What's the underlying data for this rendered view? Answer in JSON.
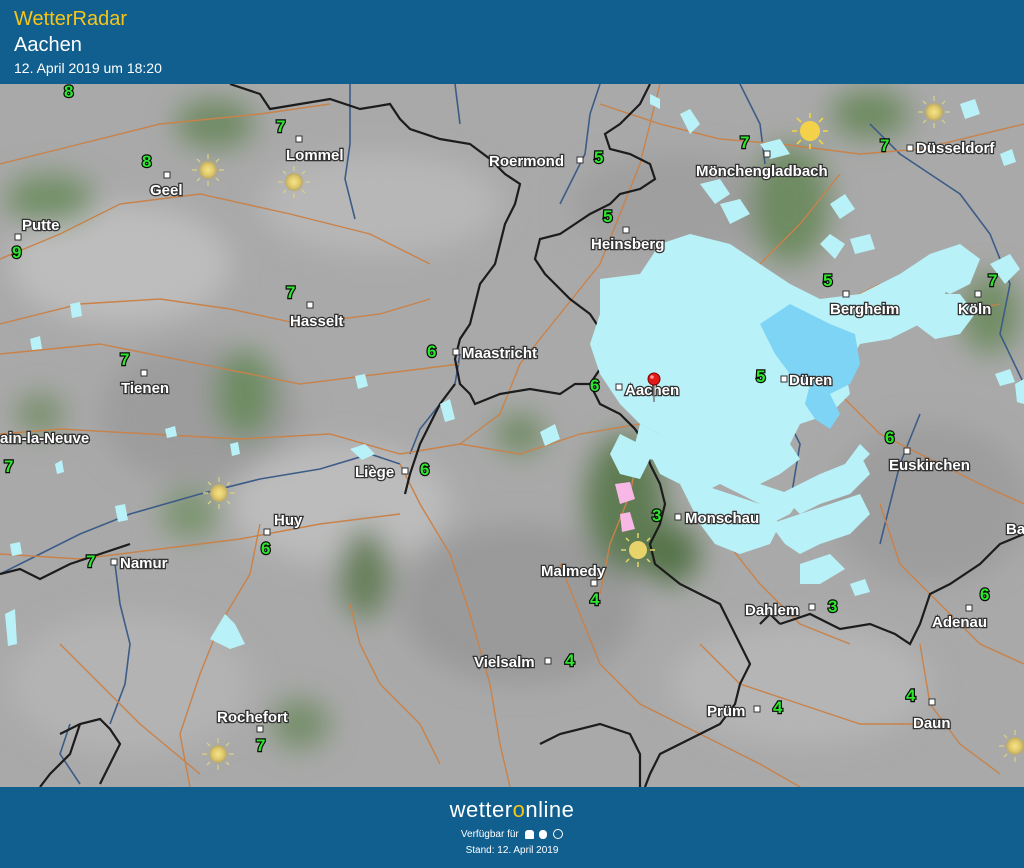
{
  "header": {
    "app_title": "WetterRadar",
    "location": "Aachen",
    "timestamp": "12. April 2019 um 18:20"
  },
  "footer": {
    "brand_pre": "wetter",
    "brand_o": "o",
    "brand_post": "nline",
    "available": "Verfügbar für",
    "platform_icons": [
      "android-icon",
      "apple-icon",
      "web-icon"
    ],
    "stand": "Stand: 12. April 2019"
  },
  "colors": {
    "header_bg": "#115f8e",
    "title_yellow": "#f5c518",
    "precip_light": "#b8f2f8",
    "precip_medium": "#7dd4f5",
    "precip_pink": "#f7b8e6",
    "temp_green": "#2ee62e"
  },
  "map": {
    "places": [
      {
        "name": "Lommel",
        "temp": "7"
      },
      {
        "name": "Geel",
        "temp": "8"
      },
      {
        "name": "Putte",
        "temp": "9"
      },
      {
        "name": "Roermond",
        "temp": "5"
      },
      {
        "name": "Mönchengladbach",
        "temp": "7"
      },
      {
        "name": "Düsseldorf",
        "temp": "7"
      },
      {
        "name": "Heinsberg",
        "temp": "5"
      },
      {
        "name": "Hasselt",
        "temp": "7"
      },
      {
        "name": "Bergheim",
        "temp": "5"
      },
      {
        "name": "Köln",
        "temp": "7"
      },
      {
        "name": "Maastricht",
        "temp": "6"
      },
      {
        "name": "Tienen",
        "temp": "7"
      },
      {
        "name": "Aachen",
        "temp": "6"
      },
      {
        "name": "Düren",
        "temp": "5"
      },
      {
        "name": "ain-la-Neuve",
        "temp": "7"
      },
      {
        "name": "Liège",
        "temp": "6"
      },
      {
        "name": "Euskirchen",
        "temp": "6"
      },
      {
        "name": "Huy",
        "temp": "6"
      },
      {
        "name": "Monschau",
        "temp": "3"
      },
      {
        "name": "Namur",
        "temp": "7"
      },
      {
        "name": "Malmedy",
        "temp": "4"
      },
      {
        "name": "Dahlem",
        "temp": "3"
      },
      {
        "name": "Adenau",
        "temp": "6"
      },
      {
        "name": "Vielsalm",
        "temp": "4"
      },
      {
        "name": "Prüm",
        "temp": "4"
      },
      {
        "name": "Rochefort",
        "temp": "7"
      },
      {
        "name": "Daun",
        "temp": "4"
      },
      {
        "name": "Ba",
        "temp": ""
      }
    ],
    "extra_temp": "8"
  }
}
